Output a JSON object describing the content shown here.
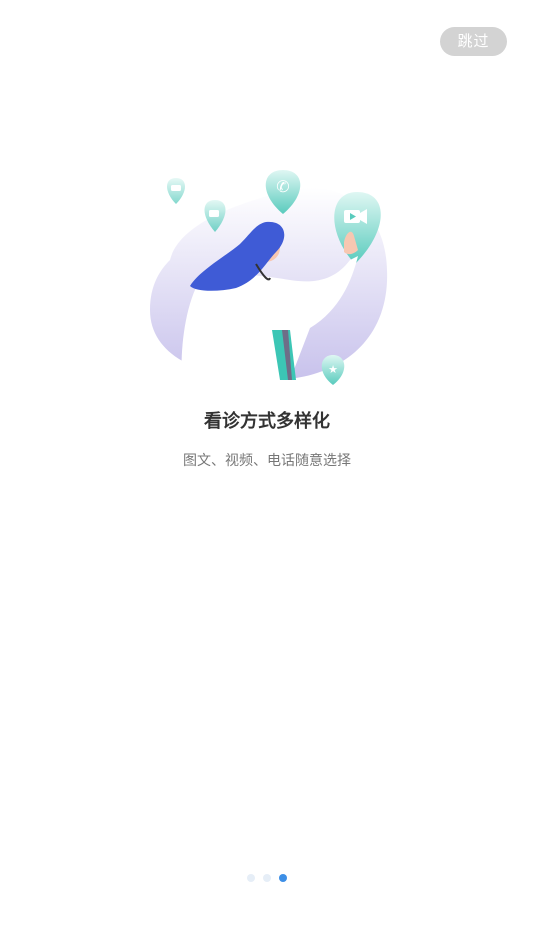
{
  "header": {
    "skip_label": "跳过"
  },
  "onboarding": {
    "title": "看诊方式多样化",
    "subtitle": "图文、视频、电话随意选择"
  },
  "illustration": {
    "icons": [
      "chat-icon",
      "message-icon",
      "phone-icon",
      "video-icon",
      "star-icon"
    ]
  },
  "pager": {
    "count": 3,
    "active_index": 2
  },
  "colors": {
    "accent": "#3d8fe6",
    "teal": "#3cc6b5",
    "hair": "#3f5bd6",
    "blob": "#d9d6f2"
  }
}
